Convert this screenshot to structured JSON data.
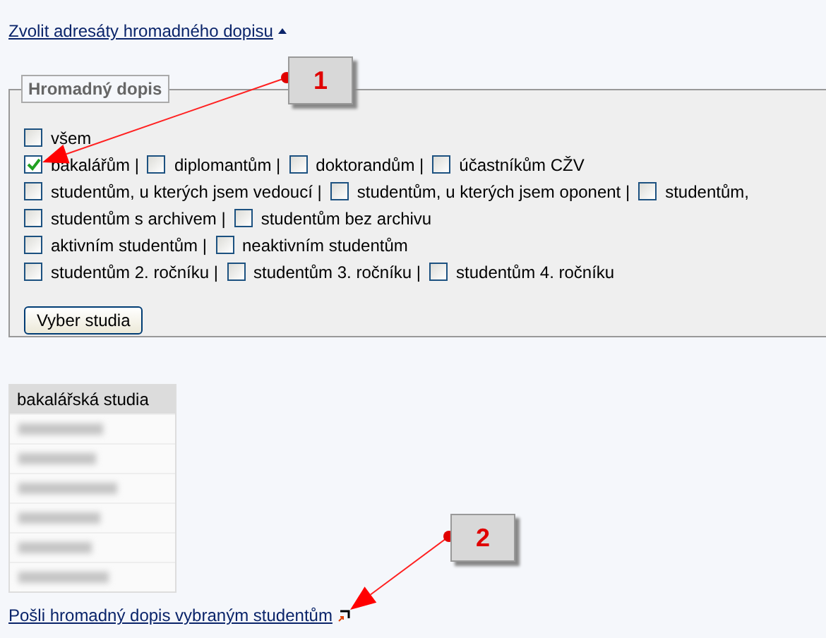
{
  "toggle_link": {
    "label": "Zvolit adresáty hromadného dopisu",
    "expanded": true
  },
  "fieldset": {
    "legend": "Hromadný dopis",
    "lines": [
      {
        "options": [
          {
            "label": "všem",
            "checked": false
          }
        ]
      },
      {
        "options": [
          {
            "label": "bakalářům |",
            "checked": true
          },
          {
            "label": "diplomantům |",
            "checked": false
          },
          {
            "label": "doktorandům |",
            "checked": false
          },
          {
            "label": "účastníkům CŽV",
            "checked": false
          }
        ]
      },
      {
        "options": [
          {
            "label": "studentům, u kterých jsem vedoucí |",
            "checked": false
          },
          {
            "label": "studentům, u kterých jsem oponent |",
            "checked": false
          },
          {
            "label": "studentům,",
            "checked": false
          }
        ]
      },
      {
        "options": [
          {
            "label": "studentům s archivem |",
            "checked": false
          },
          {
            "label": "studentům bez archivu",
            "checked": false
          }
        ]
      },
      {
        "options": [
          {
            "label": "aktivním studentům |",
            "checked": false
          },
          {
            "label": "neaktivním studentům",
            "checked": false
          }
        ]
      },
      {
        "options": [
          {
            "label": "studentům 2. ročníku |",
            "checked": false
          },
          {
            "label": "studentům 3. ročníku |",
            "checked": false
          },
          {
            "label": "studentům 4. ročníku",
            "checked": false
          }
        ]
      }
    ],
    "button": "Vyber studia"
  },
  "table": {
    "header": "bakalářská studia",
    "rows": [
      {
        "kind": "redacted"
      },
      {
        "kind": "redacted"
      },
      {
        "kind": "redacted"
      },
      {
        "kind": "redacted"
      },
      {
        "kind": "redacted"
      },
      {
        "kind": "redacted"
      }
    ]
  },
  "send_link": "Pošli hromadný dopis vybraným studentům",
  "callouts": [
    {
      "number": "1"
    },
    {
      "number": "2"
    }
  ]
}
